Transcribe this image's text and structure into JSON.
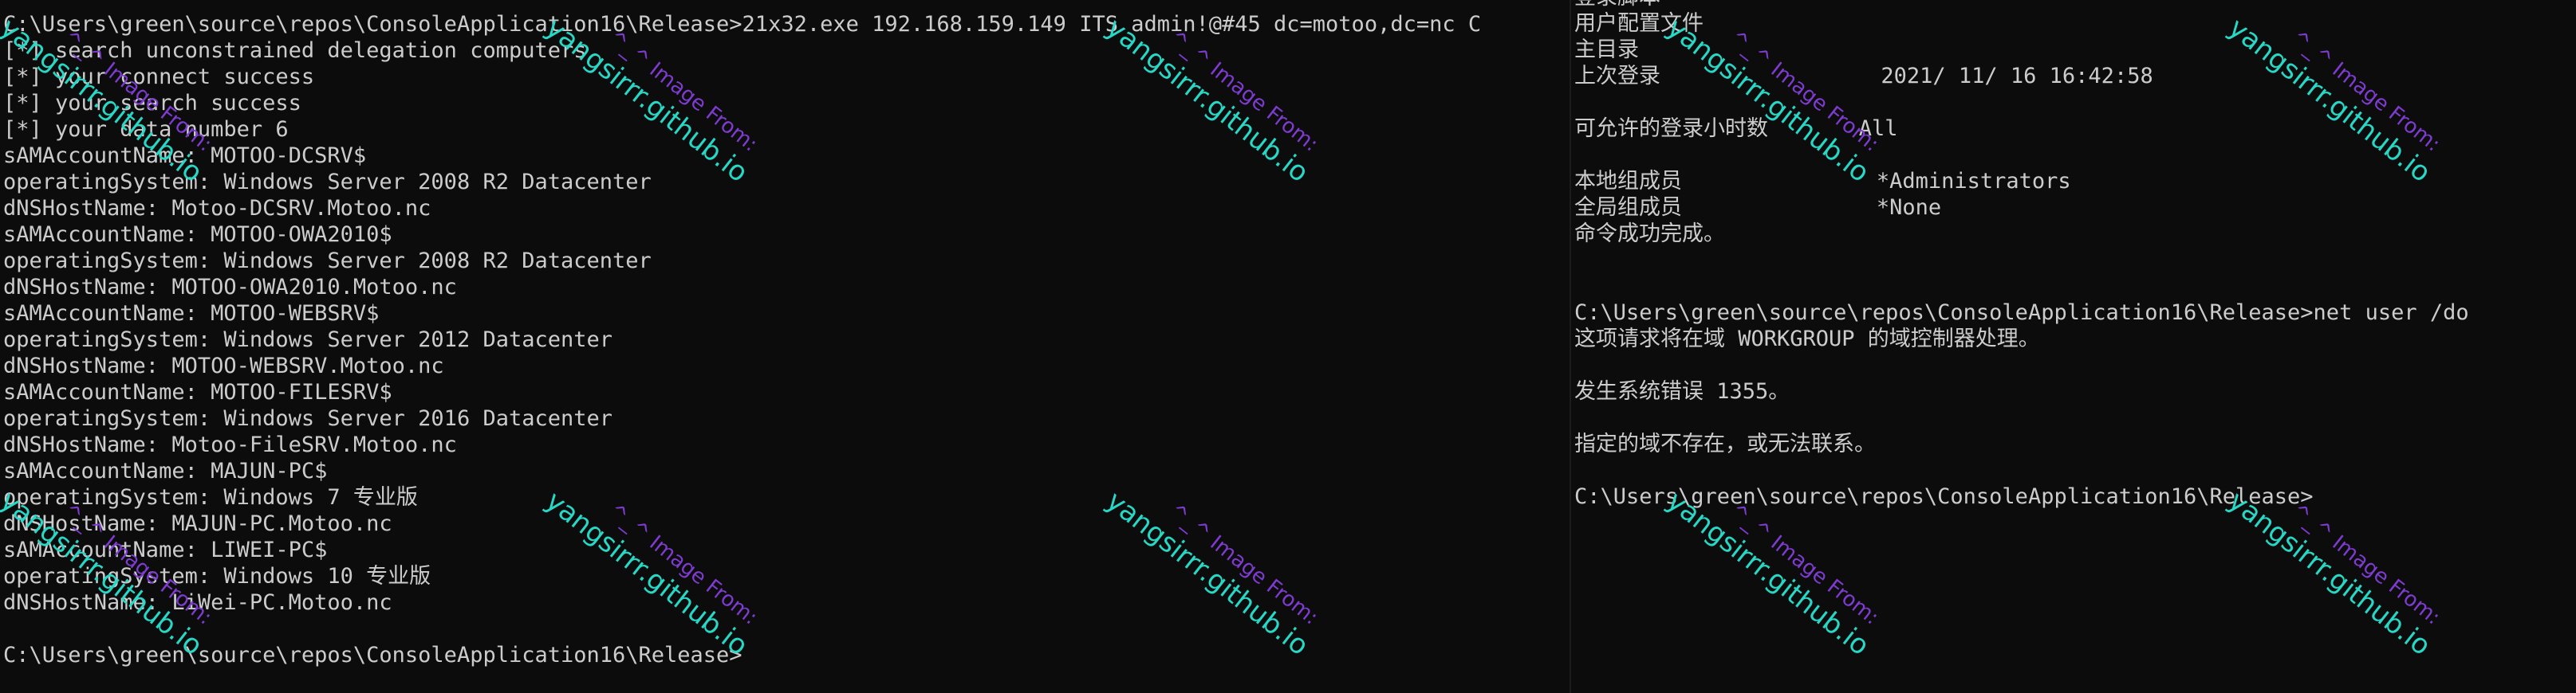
{
  "left_terminal": {
    "lines": [
      "C:\\Users\\green\\source\\repos\\ConsoleApplication16\\Release>21x32.exe 192.168.159.149 ITS admin!@#45 dc=motoo,dc=nc C",
      "[*] search unconstrained delegation computers",
      "[*] your connect success",
      "[*] your search success",
      "[*] your data number 6",
      "sAMAccountName: MOTOO-DCSRV$",
      "operatingSystem: Windows Server 2008 R2 Datacenter",
      "dNSHostName: Motoo-DCSRV.Motoo.nc",
      "sAMAccountName: MOTOO-OWA2010$",
      "operatingSystem: Windows Server 2008 R2 Datacenter",
      "dNSHostName: MOTOO-OWA2010.Motoo.nc",
      "sAMAccountName: MOTOO-WEBSRV$",
      "operatingSystem: Windows Server 2012 Datacenter",
      "dNSHostName: MOTOO-WEBSRV.Motoo.nc",
      "sAMAccountName: MOTOO-FILESRV$",
      "operatingSystem: Windows Server 2016 Datacenter",
      "dNSHostName: Motoo-FileSRV.Motoo.nc",
      "sAMAccountName: MAJUN-PC$",
      "operatingSystem: Windows 7 专业版",
      "dNSHostName: MAJUN-PC.Motoo.nc",
      "sAMAccountName: LIWEI-PC$",
      "operatingSystem: Windows 10 专业版",
      "dNSHostName: LiWei-PC.Motoo.nc",
      "",
      "C:\\Users\\green\\source\\repos\\ConsoleApplication16\\Release>"
    ]
  },
  "right_terminal": {
    "lines": [
      "登录脚本",
      "用户配置文件",
      "主目录",
      "上次登录                 2021/ 11/ 16 16:42:58",
      "",
      "可允许的登录小时数       All",
      "",
      "本地组成员               *Administrators",
      "全局组成员               *None",
      "命令成功完成。",
      "",
      "",
      "C:\\Users\\green\\source\\repos\\ConsoleApplication16\\Release>net user /do",
      "这项请求将在域 WORKGROUP 的域控制器处理。",
      "",
      "发生系统错误 1355。",
      "",
      "指定的域不存在，或无法联系。",
      "",
      "C:\\Users\\green\\source\\repos\\ConsoleApplication16\\Release>"
    ]
  },
  "watermark": {
    "small": "^_^ Image From:",
    "big": "yangsirrr.github.io"
  }
}
